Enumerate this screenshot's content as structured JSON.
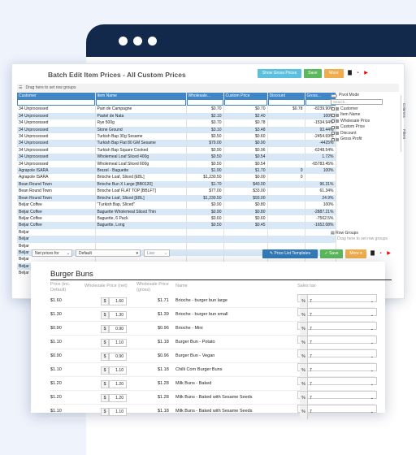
{
  "top_grid": {
    "title": "Batch Edit Item Prices - All Custom Prices",
    "buttons": {
      "show_gross": "Show Gross Prices",
      "save": "Save",
      "more": "More"
    },
    "drag_hint": "Drag here to set row groups",
    "columns": [
      "Customer",
      "Item Name",
      "Wholesale...",
      "Custom Price",
      "Discount",
      "Gross..."
    ],
    "rows": [
      [
        "34 Unprocessed",
        "Pain de Campagne",
        "$0.70",
        "$0.70",
        "$0.78",
        "-8239.90%"
      ],
      [
        "34 Unprocessed",
        "Pastel de Nata",
        "$2.10",
        "$2.40",
        "",
        "100%"
      ],
      [
        "34 Unprocessed",
        "Rye 500g",
        "$0.70",
        "$0.78",
        "",
        "-1534.94%"
      ],
      [
        "34 Unprocessed",
        "Stone Ground",
        "$3.10",
        "$3.48",
        "",
        "93.44%"
      ],
      [
        "34 Unprocessed",
        "Turkish Bap 30g Sesame",
        "$0.50",
        "$0.60",
        "",
        "-2454.69%"
      ],
      [
        "34 Unprocessed",
        "Turkish Bap Flat 80 GM Sesame",
        "$79.00",
        "$0.90",
        "",
        "-4425%"
      ],
      [
        "34 Unprocessed",
        "Turkish Bap Square Cooked",
        "$0.90",
        "$0.96",
        "",
        "-6248.54%"
      ],
      [
        "34 Unprocessed",
        "Wholemeal Loaf Sliced 400g",
        "$0.50",
        "$0.54",
        "",
        "1.72%"
      ],
      [
        "34 Unprocessed",
        "Wholemeal Loaf Sliced 600g",
        "$0.50",
        "$0.54",
        "",
        "-65783.45%"
      ],
      [
        "Agrapole ISARA",
        "Brezel - Baguette",
        "$1.90",
        "$1.70",
        "0",
        "100%"
      ],
      [
        "Agrapole ISARA",
        "Brioche Loaf, Sliced [EBL]",
        "$1,230.50",
        "$0.00",
        "0",
        ""
      ],
      [
        "Bean Round Town",
        "Brioche Bun X Large [BB0120]",
        "$1.70",
        "$40.00",
        "",
        "96.31%"
      ],
      [
        "Bean Round Town",
        "Brioche Loaf FLAT TOP [BBLFT]",
        "$77.00",
        "$33.00",
        "",
        "61.34%"
      ],
      [
        "Bean Round Town",
        "Brioche Loaf, Sliced [EBL]",
        "$1,230.50",
        "$93.00",
        "",
        "24.9%"
      ],
      [
        "Beljar Coffee",
        "\"Turkish Bap, Sliced\"",
        "$0.90",
        "$0.80",
        "",
        "100%"
      ],
      [
        "Beljar Coffee",
        "Baguette Wholemeal Sliced Thin",
        "$0.90",
        "$0.80",
        "",
        "-2887.21%"
      ],
      [
        "Beljar Coffee",
        "Baguette, 6 Pack",
        "$0.60",
        "$0.60",
        "",
        "-7562.5%"
      ],
      [
        "Beljar Coffee",
        "Baguette, Long",
        "$0.50",
        "$0.45",
        "",
        "-1652.08%"
      ]
    ],
    "extra_customers": [
      "Beljar",
      "Beljar",
      "Beljar",
      "Beljar",
      "Beljar",
      "Beljar",
      "Beljar"
    ],
    "side_panel": {
      "pivot_mode": "Pivot Mode",
      "search_placeholder": "Search...",
      "columns": [
        "Customer",
        "Item Name",
        "Wholesale Price",
        "Custom Price",
        "Discount",
        "Gross Profit"
      ],
      "row_groups": "Row Groups",
      "row_groups_hint": "Drag here to set row groups",
      "tabs": [
        "Columns",
        "Filters"
      ]
    },
    "footer": {
      "net_prices_for": "Net prices for",
      "price_list": "Default",
      "live": "Live",
      "price_list_templates": "Price List Templates",
      "save": "Save",
      "more": "More"
    },
    "colors": {
      "header": "#3f86c7",
      "alt_row": "#d9e8f6",
      "save": "#5cb85c",
      "more": "#f0ad4e",
      "primary": "#337ab7",
      "show_gross": "#5bc0de"
    }
  },
  "product_card": {
    "title": "Burger Buns",
    "headers": {
      "price_inc": "Price (inc. Default)",
      "wholesale": "Wholesale Price (net)",
      "gross": "Wholesale Price (gross)",
      "name": "Name",
      "sales_tax": "Sales tax"
    },
    "rows": [
      {
        "price": "$1.60",
        "net": "1.60",
        "gross": "$1.71",
        "name": "Brioche - burger bun large",
        "tax": "7"
      },
      {
        "price": "$1.30",
        "net": "1.30",
        "gross": "$1.39",
        "name": "Brioche - burger bun small",
        "tax": "7"
      },
      {
        "price": "$0.90",
        "net": "0.90",
        "gross": "$0.96",
        "name": "Brioche - Mini",
        "tax": "7"
      },
      {
        "price": "$1.10",
        "net": "1.10",
        "gross": "$1.18",
        "name": "Burger Bun - Potato",
        "tax": "7"
      },
      {
        "price": "$0.90",
        "net": "0.90",
        "gross": "$0.96",
        "name": "Burger Bun - Vegan",
        "tax": "7"
      },
      {
        "price": "$1.10",
        "net": "1.10",
        "gross": "$1.18",
        "name": "Chilli Corn Burger Buns",
        "tax": "7"
      },
      {
        "price": "$1.20",
        "net": "1.20",
        "gross": "$1.28",
        "name": "Milk Buns - Baked",
        "tax": "7"
      },
      {
        "price": "$1.20",
        "net": "1.20",
        "gross": "$1.28",
        "name": "Milk Buns - Baked with Sesame Seeds",
        "tax": "7"
      },
      {
        "price": "$1.10",
        "net": "1.10",
        "gross": "$1.18",
        "name": "Milk Buns - Baked with Sesame Seeds",
        "tax": "7"
      }
    ],
    "dollar": "$",
    "percent": "%"
  }
}
